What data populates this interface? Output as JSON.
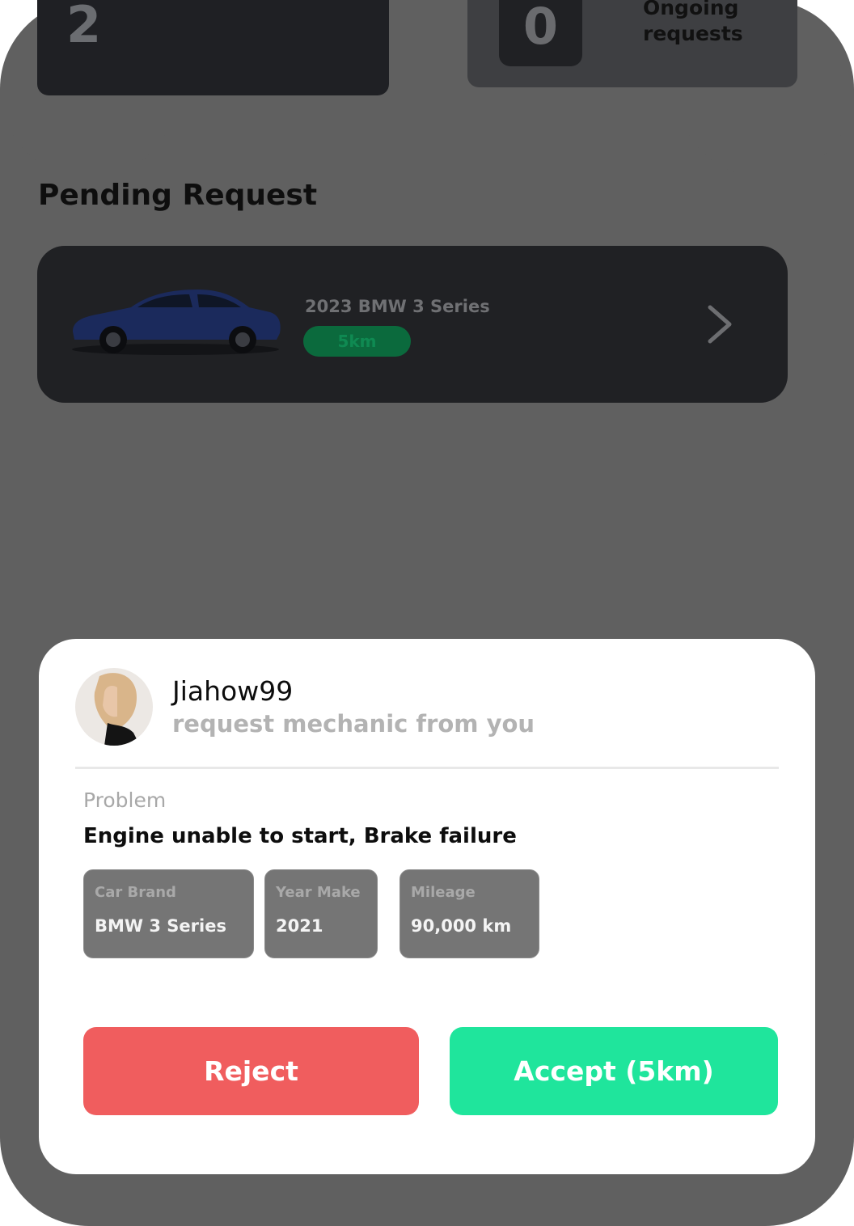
{
  "stats": {
    "left_count": "2",
    "right_count": "0",
    "right_label": "Ongoing requests"
  },
  "pending": {
    "heading": "Pending Request",
    "card": {
      "car_title": "2023 BMW 3 Series",
      "distance": "5km",
      "car_color": "#1b2a5c",
      "distance_color": "#0b6a3d"
    }
  },
  "modal": {
    "username": "Jiahow99",
    "subtitle": "request mechanic from you",
    "problem_label": "Problem",
    "problem_text": "Engine unable to start, Brake failure",
    "chips": [
      {
        "label": "Car Brand",
        "value": "BMW 3 Series"
      },
      {
        "label": "Year Make",
        "value": "2021"
      },
      {
        "label": "Mileage",
        "value": "90,000 km"
      }
    ],
    "reject_label": "Reject",
    "accept_label": "Accept (5km)",
    "reject_color": "#f05d5e",
    "accept_color": "#1fe59c"
  }
}
